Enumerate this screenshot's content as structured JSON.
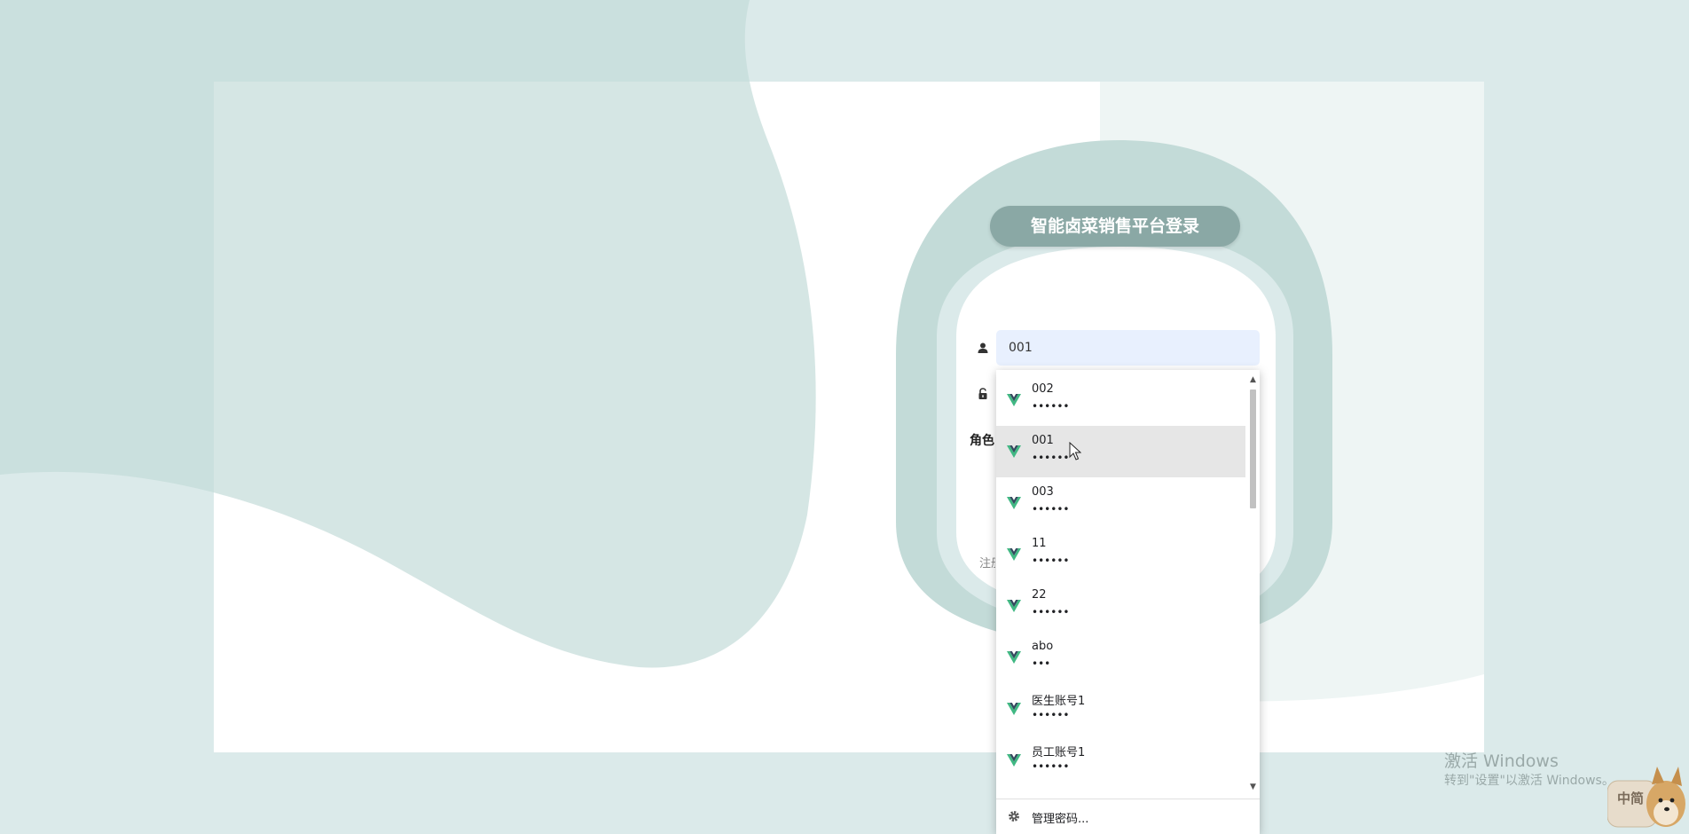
{
  "login": {
    "title": "智能卤菜销售平台登录",
    "username_value": "001",
    "role_label": "角色",
    "register_text": "注册"
  },
  "autofill": {
    "items": [
      {
        "username": "002",
        "password": "••••••"
      },
      {
        "username": "001",
        "password": "••••••"
      },
      {
        "username": "003",
        "password": "••••••"
      },
      {
        "username": "11",
        "password": "••••••"
      },
      {
        "username": "22",
        "password": "••••••"
      },
      {
        "username": "abo",
        "password": "•••"
      },
      {
        "username": "医生账号1",
        "password": "••••••"
      },
      {
        "username": "员工账号1",
        "password": "••••••"
      }
    ],
    "hovered_index": 1,
    "manage_label": "管理密码..."
  },
  "watermark": {
    "line1": "激活 Windows",
    "line2": "转到\"设置\"以激活 Windows。"
  },
  "ime": {
    "label": "中简"
  },
  "colors": {
    "page_bg": "#dbeaea",
    "blob_dark": "#c3dbd8",
    "title_pill": "#8aa8a5",
    "input_fill": "#e8f0fe",
    "vue_green": "#41b883",
    "vue_dark": "#34495e"
  },
  "icons": [
    "user-icon",
    "lock-icon",
    "vue-logo-icon",
    "gear-icon",
    "scroll-up-icon",
    "scroll-down-icon",
    "mouse-cursor-icon"
  ]
}
